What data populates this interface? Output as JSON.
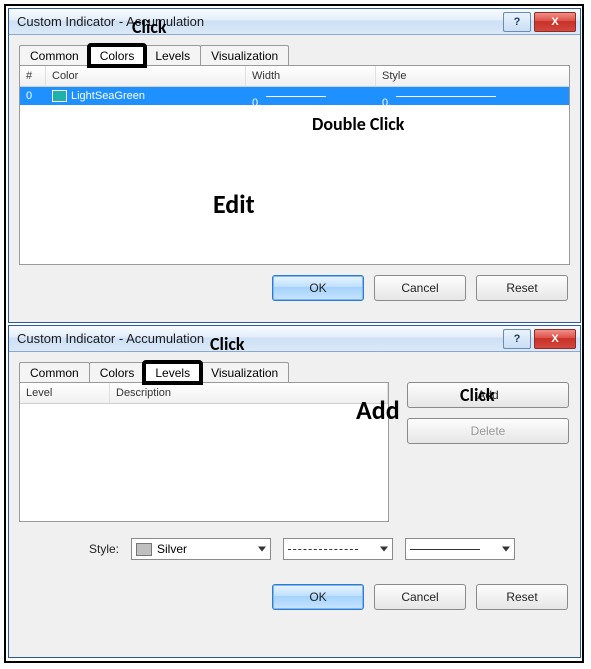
{
  "dialog1": {
    "title": "Custom Indicator - Accumulation",
    "tabs": [
      "Common",
      "Colors",
      "Levels",
      "Visualization"
    ],
    "active_tab": "Colors",
    "columns": {
      "idx": "#",
      "color": "Color",
      "width": "Width",
      "style": "Style"
    },
    "row": {
      "index": "0",
      "color_name": "LightSeaGreen",
      "color_hex": "#20b2aa",
      "width_label": "0.",
      "style_label": "0."
    },
    "buttons": {
      "ok": "OK",
      "cancel": "Cancel",
      "reset": "Reset"
    }
  },
  "dialog2": {
    "title": "Custom Indicator - Accumulation",
    "tabs": [
      "Common",
      "Colors",
      "Levels",
      "Visualization"
    ],
    "active_tab": "Levels",
    "columns": {
      "level": "Level",
      "description": "Description"
    },
    "side_buttons": {
      "add": "Add",
      "delete": "Delete"
    },
    "style_label": "Style:",
    "style_value": "Silver",
    "buttons": {
      "ok": "OK",
      "cancel": "Cancel",
      "reset": "Reset"
    }
  },
  "annotations": {
    "click1": "Click",
    "double_click": "Double Click",
    "edit": "Edit",
    "click2": "Click",
    "add": "Add",
    "click3": "Click"
  },
  "titlebar": {
    "help": "?",
    "close": "X"
  }
}
